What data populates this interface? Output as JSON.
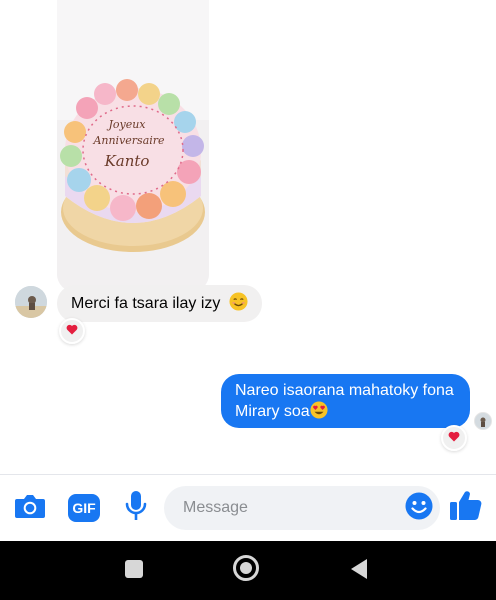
{
  "conversation": {
    "photo": {
      "cake_text": [
        "Joyeux",
        "Anniversaire",
        "Kanto"
      ]
    },
    "incoming": {
      "text": "Merci fa tsara ilay izy",
      "emoji": "smiling-face-with-smiling-eyes",
      "reaction": "heart"
    },
    "outgoing": {
      "line1": "Nareo isaorana mahatoky fona",
      "line2": "Mirary soa",
      "emoji": "smiling-face-with-heart-eyes",
      "reaction": "heart"
    }
  },
  "composer": {
    "placeholder": "Message",
    "gif_label": "GIF",
    "icons": [
      "camera-icon",
      "gif-icon",
      "microphone-icon",
      "emoji-icon",
      "thumbs-up-icon"
    ]
  },
  "navbar": {
    "icons": [
      "square-recents-icon",
      "circle-home-icon",
      "triangle-back-icon"
    ]
  },
  "colors": {
    "accent": "#1877f2",
    "incoming_bubble": "#f1f0f0",
    "heart": "#e41e3f",
    "navbar": "#000000"
  }
}
